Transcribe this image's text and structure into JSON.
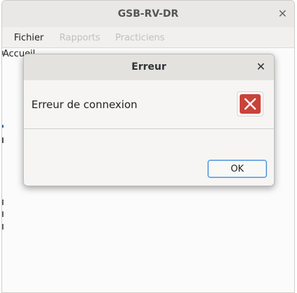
{
  "window": {
    "title": "GSB-RV-DR",
    "close_icon": "close-icon"
  },
  "menu": {
    "items": [
      {
        "label": "Fichier",
        "enabled": true
      },
      {
        "label": "Rapports",
        "enabled": false
      },
      {
        "label": "Practiciens",
        "enabled": false
      }
    ]
  },
  "content": {
    "heading": "Accueil"
  },
  "dialog": {
    "title": "Erreur",
    "message": "Erreur de connexion",
    "icon": "error-icon",
    "ok_label": "OK",
    "colors": {
      "error": "#c9433a",
      "focus": "#4a90d9"
    }
  }
}
